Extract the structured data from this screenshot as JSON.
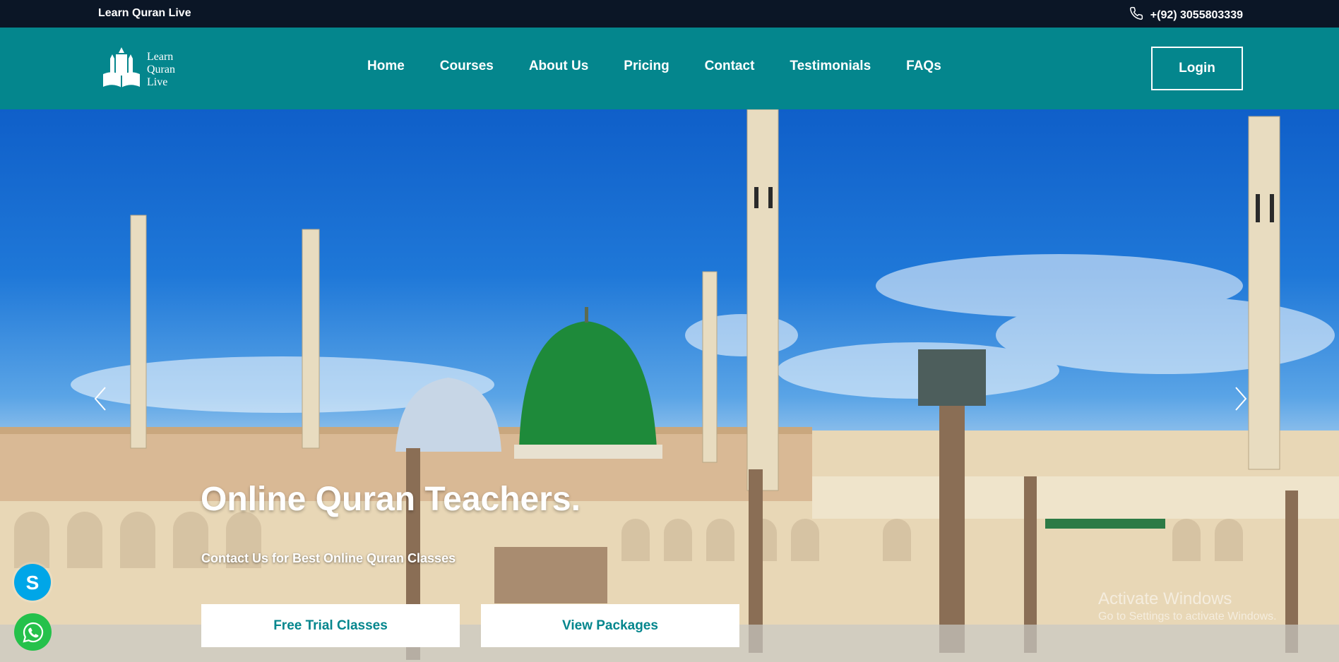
{
  "topbar": {
    "brand": "Learn Quran Live",
    "phone": "+(92) 3055803339"
  },
  "navbar": {
    "logo_text": [
      "Learn",
      "Quran",
      "Live"
    ],
    "links": [
      "Home",
      "Courses",
      "About Us",
      "Pricing",
      "Contact",
      "Testimonials",
      "FAQs"
    ],
    "login_label": "Login"
  },
  "hero": {
    "title": "Online Quran Teachers.",
    "subtitle": "Contact Us for Best Online Quran Classes",
    "cta_trial": "Free Trial Classes",
    "cta_packages": "View Packages"
  },
  "watermark": {
    "line1": "Activate Windows",
    "line2": "Go to Settings to activate Windows."
  },
  "colors": {
    "topbar_bg": "#0b1626",
    "nav_bg": "#04868d",
    "accent_text": "#04868d",
    "skype": "#00a6e8",
    "whatsapp": "#25c14b"
  },
  "icons": {
    "phone": "phone-icon",
    "logo": "logo-icon",
    "prev": "chevron-left-icon",
    "next": "chevron-right-icon",
    "skype": "skype-icon",
    "whatsapp": "whatsapp-icon"
  }
}
